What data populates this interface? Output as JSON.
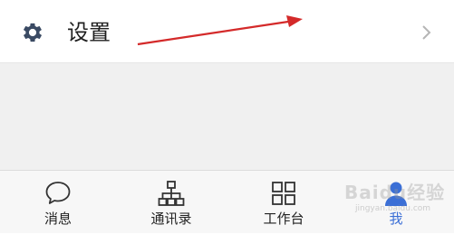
{
  "settings_row": {
    "label": "设置",
    "icon": "gear-icon",
    "chevron_icon": "chevron-right-icon"
  },
  "tabbar": {
    "tabs": [
      {
        "label": "消息",
        "icon": "chat-bubble-icon",
        "active": false
      },
      {
        "label": "通讯录",
        "icon": "org-chart-icon",
        "active": false
      },
      {
        "label": "工作台",
        "icon": "grid-icon",
        "active": false
      },
      {
        "label": "我",
        "icon": "person-icon",
        "active": true
      }
    ]
  },
  "annotation": {
    "type": "red-arrow",
    "color": "#d42a2a"
  },
  "watermark": {
    "text": "Baidu经验",
    "sub": "jingyan.baidu.com"
  },
  "colors": {
    "accent": "#3b6fd6",
    "icon": "#3a4a63",
    "arrow": "#d42a2a"
  }
}
